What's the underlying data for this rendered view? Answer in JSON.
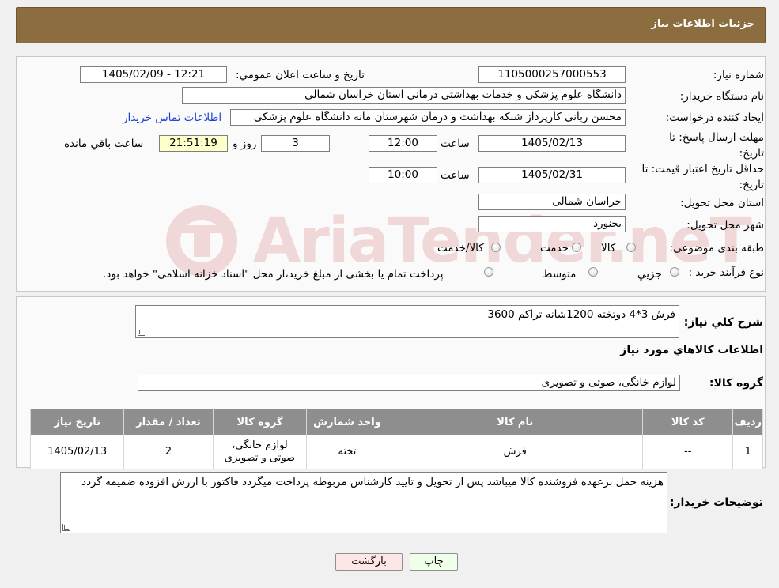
{
  "header": {
    "title": "جزئیات اطلاعات نیاز"
  },
  "form": {
    "need_number_label": "شماره نیاز:",
    "need_number": "1105000257000553",
    "announce_label": "تاریخ و ساعت اعلان عمومي:",
    "announce_value": "1405/02/09 - 12:21",
    "buyer_label": "نام دستگاه خريدار:",
    "buyer_value": "دانشگاه علوم پزشکی و خدمات بهداشتی درمانی استان خراسان شمالی",
    "creator_label": "ايجاد کننده درخواست:",
    "creator_value": "محسن ربانی کارپرداز شبکه بهداشت و درمان شهرستان مانه دانشگاه علوم پزشکی",
    "contact_link": "اطلاعات تماس خريدار",
    "deadline_label": "مهلت ارسال پاسخ: تا تاريخ:",
    "deadline_date": "1405/02/13",
    "time_label": "ساعت",
    "deadline_time": "12:00",
    "days_value": "3",
    "days_and": "روز و",
    "remaining_time": "21:51:19",
    "remaining_label": "ساعت باقي مانده",
    "validity_label": "حداقل تاريخ اعتبار قيمت: تا تاريخ:",
    "validity_date": "1405/02/31",
    "validity_time": "10:00",
    "province_label": "استان محل تحويل:",
    "province_value": "خراسان شمالی",
    "city_label": "شهر محل تحويل:",
    "city_value": "بجنورد",
    "category_label": "طبقه بندی موضوعی:",
    "category_options": [
      "کالا",
      "خدمت",
      "کالا/خدمت"
    ],
    "process_label": "نوع فرآيند خريد :",
    "process_options": [
      "جزيي",
      "متوسط"
    ],
    "process_note": "پرداخت تمام يا بخشی از مبلغ خريد،از محل \"اسناد خزانه اسلامی\" خواهد بود."
  },
  "summary": {
    "label": "شرح کلي نياز:",
    "value": "فرش 3*4 دوتخته 1200شانه تراکم 3600",
    "items_title": "اطلاعات کالاهاي مورد نياز",
    "group_label": "گروه کالا:",
    "group_value": "لوازم خانگی، صوتی و تصویری"
  },
  "table": {
    "headers": [
      "رديف",
      "کد کالا",
      "نام کالا",
      "واحد شمارش",
      "گروه کالا",
      "تعداد / مقدار",
      "تاريخ نياز"
    ],
    "rows": [
      {
        "row": "1",
        "code": "--",
        "name": "فرش",
        "unit": "تخته",
        "group": "لوازم خانگی، صوتی و تصویری",
        "qty": "2",
        "date": "1405/02/13"
      }
    ]
  },
  "notes": {
    "label": "توضيحات خريدار:",
    "value": "هزینه حمل برعهده فروشنده کالا میباشد پس از تحویل و تایید کارشناس مربوطه پرداخت میگردد فاکتور با ارزش افزوده ضمیمه گردد"
  },
  "buttons": {
    "print": "چاپ",
    "back": "بازگشت"
  },
  "watermark": {
    "text": "AriaTender.neT"
  }
}
